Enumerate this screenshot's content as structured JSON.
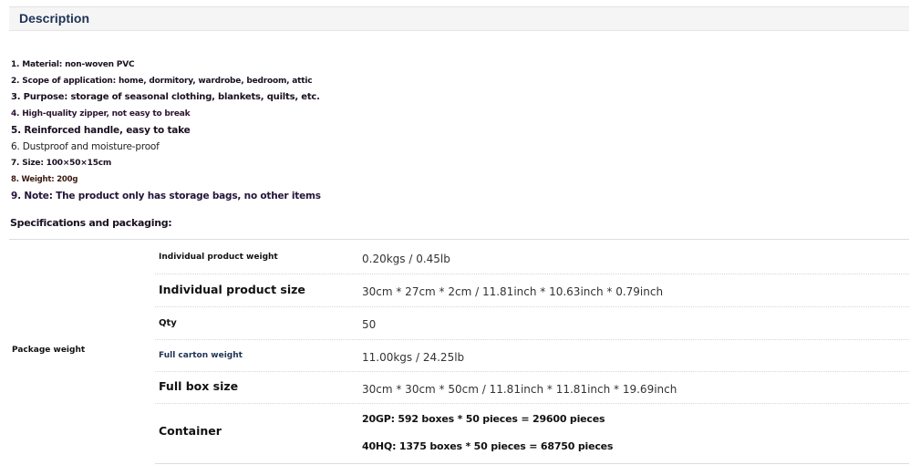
{
  "description": {
    "title": "Description"
  },
  "features": [
    "1. Material: non-woven PVC",
    "2. Scope of application: home, dormitory, wardrobe, bedroom, attic",
    "3. Purpose: storage of seasonal clothing, blankets, quilts, etc.",
    "4. High-quality zipper, not easy to break",
    "5. Reinforced handle, easy to take",
    "6. Dustproof and moisture-proof",
    "7. Size: 100×50×15cm",
    "8. Weight: 200g",
    "9. Note: The product only has storage bags, no other items"
  ],
  "specs": {
    "heading": "Specifications and packaging:",
    "group_label": "Package weight",
    "rows": [
      {
        "key": "Individual product weight",
        "value": "0.20kgs / 0.45lb"
      },
      {
        "key": "Individual product size",
        "value": "30cm * 27cm * 2cm / 11.81inch * 10.63inch * 0.79inch"
      },
      {
        "key": "Qty",
        "value": "50"
      },
      {
        "key": "Full carton weight",
        "value": "11.00kgs / 24.25lb"
      },
      {
        "key": "Full box size",
        "value": "30cm * 30cm * 50cm / 11.81inch * 11.81inch * 19.69inch"
      },
      {
        "key": "Container",
        "values": [
          "20GP: 592 boxes * 50 pieces = 29600 pieces",
          "40HQ: 1375 boxes * 50 pieces = 68750 pieces"
        ]
      }
    ]
  },
  "colors": {
    "header_title": "#1e3356",
    "header_bg": "#f5f5f5",
    "text": "#111111"
  }
}
